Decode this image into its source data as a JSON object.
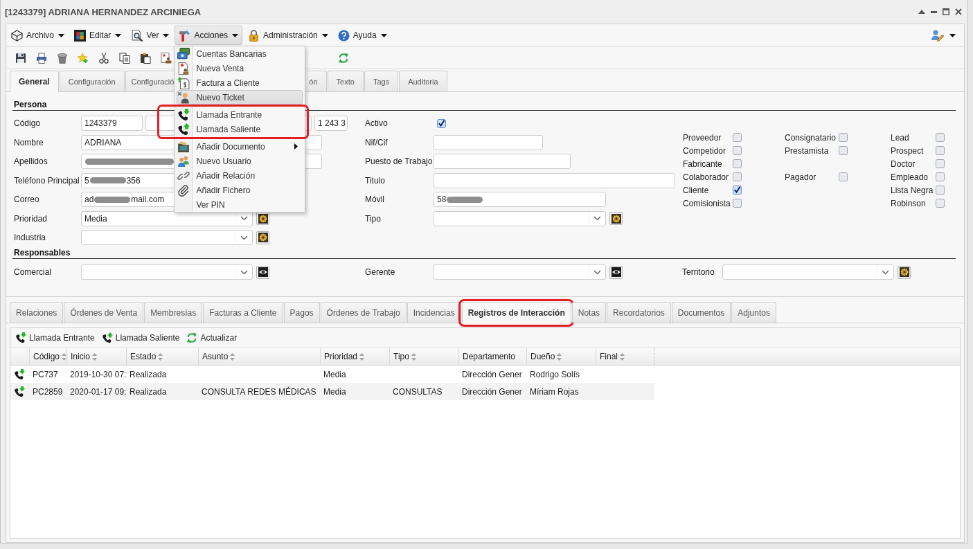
{
  "window": {
    "title": "[1243379] ADRIANA HERNANDEZ ARCINIEGA"
  },
  "menu_bar": [
    {
      "label": "Archivo",
      "open": false
    },
    {
      "label": "Editar",
      "open": false
    },
    {
      "label": "Ver",
      "open": false
    },
    {
      "label": "Acciones",
      "open": true,
      "sections": [
        {
          "circled": false,
          "items": [
            {
              "label": "Cuentas Bancarias",
              "hovered": false,
              "submenu": false
            },
            {
              "label": "Nueva Venta",
              "hovered": false,
              "submenu": false
            },
            {
              "label": "Factura a Cliente",
              "hovered": false,
              "submenu": false
            },
            {
              "label": "Nuevo Ticket",
              "hovered": true,
              "submenu": false
            }
          ]
        },
        {
          "circled": true,
          "items": [
            {
              "label": "Llamada Entrante",
              "hovered": false,
              "submenu": false
            },
            {
              "label": "Llamada Saliente",
              "hovered": false,
              "submenu": false
            }
          ]
        },
        {
          "circled": false,
          "items": [
            {
              "label": "Añadir Documento",
              "hovered": false,
              "submenu": true
            },
            {
              "label": "Nuevo Usuario",
              "hovered": false,
              "submenu": false
            },
            {
              "label": "Añadir Relación",
              "hovered": false,
              "submenu": false
            },
            {
              "label": "Añadir Fichero",
              "hovered": false,
              "submenu": false
            },
            {
              "label": "Ver PIN",
              "hovered": false,
              "submenu": false
            }
          ]
        }
      ]
    },
    {
      "label": "Administración",
      "open": false
    },
    {
      "label": "Ayuda",
      "open": false
    }
  ],
  "top_tabs": [
    {
      "label": "General",
      "selected": true,
      "kind": "full"
    },
    {
      "label": "Configuración",
      "selected": false,
      "kind": "full"
    },
    {
      "label": "Configuració",
      "selected": false,
      "kind": "truncated"
    },
    {
      "label": "ón",
      "selected": false,
      "kind": "remnant"
    },
    {
      "label": "Texto",
      "selected": false,
      "kind": "full"
    },
    {
      "label": "Tags",
      "selected": false,
      "kind": "full"
    },
    {
      "label": "Auditoria",
      "selected": false,
      "kind": "full"
    }
  ],
  "persona": {
    "heading": "Persona",
    "left_fields": [
      {
        "label": "Código",
        "kind": "code",
        "value": "1243379",
        "formatted": "1 243 3"
      },
      {
        "label": "Nombre",
        "kind": "text",
        "value": "ADRIANA"
      },
      {
        "label": "Apellidos",
        "kind": "text",
        "segments": [
          {
            "kind": "redaction"
          }
        ]
      },
      {
        "label": "Teléfono Principal",
        "kind": "text",
        "segments": [
          {
            "kind": "text",
            "text": "5"
          },
          {
            "kind": "redaction"
          },
          {
            "kind": "text",
            "text": "356"
          }
        ]
      },
      {
        "label": "Correo",
        "kind": "text",
        "segments": [
          {
            "kind": "text",
            "text": "ad"
          },
          {
            "kind": "redaction"
          },
          {
            "kind": "text",
            "text": "mail.com"
          }
        ]
      },
      {
        "label": "Prioridad",
        "kind": "combo",
        "value": "Media"
      },
      {
        "label": "Industria",
        "kind": "combo"
      }
    ],
    "middle_fields": [
      {
        "label": "Activo",
        "kind": "checkbox",
        "checked": true
      },
      {
        "label": "Nif/Cif",
        "kind": "text"
      },
      {
        "label": "Puesto de Trabajo",
        "kind": "text"
      },
      {
        "label": "Titulo",
        "kind": "text"
      },
      {
        "label": "Móvil",
        "kind": "text",
        "segments": [
          {
            "kind": "text",
            "text": "58"
          },
          {
            "kind": "redaction"
          }
        ]
      },
      {
        "label": "Tipo",
        "kind": "combo"
      }
    ],
    "flag_columns": [
      {
        "groups": [
          [
            {
              "label": "Proveedor",
              "checked": false
            },
            {
              "label": "Competidor",
              "checked": false
            },
            {
              "label": "Fabricante",
              "checked": false
            },
            {
              "label": "Colaborador",
              "checked": false
            },
            {
              "label": "Cliente",
              "checked": true
            },
            {
              "label": "Comisionista",
              "checked": false
            }
          ]
        ]
      },
      {
        "groups": [
          [
            {
              "label": "Consignatario",
              "checked": false
            },
            {
              "label": "Prestamista",
              "checked": false
            }
          ],
          [
            {
              "label": "Pagador",
              "checked": false
            }
          ]
        ]
      },
      {
        "groups": [
          [
            {
              "label": "Lead",
              "checked": false
            },
            {
              "label": "Prospect",
              "checked": false
            },
            {
              "label": "Doctor",
              "checked": false
            },
            {
              "label": "Empleado",
              "checked": false
            },
            {
              "label": "Lista Negra",
              "checked": false
            },
            {
              "label": "Robinson",
              "checked": false
            }
          ]
        ]
      }
    ]
  },
  "responsables": {
    "heading": "Responsables",
    "fields": [
      {
        "label": "Comercial",
        "kind": "lookup"
      },
      {
        "label": "Gerente",
        "kind": "lookup"
      },
      {
        "label": "Territorio",
        "kind": "combo"
      }
    ]
  },
  "bottom_tabs": [
    {
      "label": "Relaciones",
      "selected": false,
      "circled": false
    },
    {
      "label": "Órdenes de Venta",
      "selected": false,
      "circled": false
    },
    {
      "label": "Membresías",
      "selected": false,
      "circled": false
    },
    {
      "label": "Facturas a Cliente",
      "selected": false,
      "circled": false
    },
    {
      "label": "Pagos",
      "selected": false,
      "circled": false
    },
    {
      "label": "Órdenes de Trabajo",
      "selected": false,
      "circled": false
    },
    {
      "label": "Incidencias",
      "selected": false,
      "circled": false
    },
    {
      "label": "Registros de Interacción",
      "selected": true,
      "circled": true
    },
    {
      "label": "Notas",
      "selected": false,
      "circled": false
    },
    {
      "label": "Recordatorios",
      "selected": false,
      "circled": false
    },
    {
      "label": "Documentos",
      "selected": false,
      "circled": false
    },
    {
      "label": "Adjuntos",
      "selected": false,
      "circled": false
    }
  ],
  "interactions": {
    "toolbar": [
      {
        "label": "Llamada Entrante"
      },
      {
        "label": "Llamada Saliente"
      },
      {
        "label": "Actualizar"
      }
    ],
    "columns": [
      {
        "label": "Código",
        "sort_indicator": true
      },
      {
        "label": "Inicio",
        "sort_indicator": true
      },
      {
        "label": "Estado",
        "sort_indicator": true
      },
      {
        "label": "Asunto",
        "sort_indicator": true
      },
      {
        "label": "Prioridad",
        "sort_indicator": true
      },
      {
        "label": "Tipo",
        "sort_indicator": true
      },
      {
        "label": "Departamento",
        "sort_indicator": false
      },
      {
        "label": "Dueño",
        "sort_indicator": true
      },
      {
        "label": "Final",
        "sort_indicator": true
      }
    ],
    "rows": [
      {
        "code": "PC737",
        "start": "2019-10-30 07:",
        "status": "Realizada",
        "priority": "Media",
        "department": "Dirección Gener",
        "owner": "Rodrigo Solís"
      },
      {
        "code": "PC2859",
        "start": "2020-01-17 09:",
        "status": "Realizada",
        "subject": "CONSULTA REDES MÉDICAS",
        "priority": "Media",
        "type": "CONSULTAS",
        "department": "Dirección Gener",
        "owner": "Míriam Rojas"
      }
    ]
  }
}
